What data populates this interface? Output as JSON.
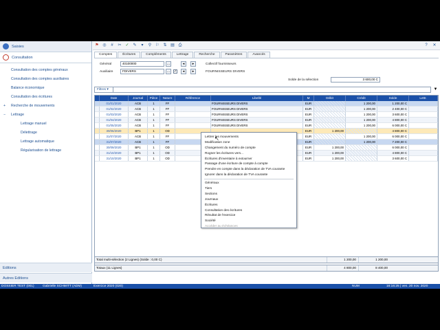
{
  "sidebar": {
    "header_saisies": "Saisies",
    "header_consultation": "Consultation",
    "items": [
      {
        "label": "Consultation des comptes généraux"
      },
      {
        "label": "Consultation des comptes auxiliaires"
      },
      {
        "label": "Balance économique"
      },
      {
        "label": "Consultation des écritures"
      }
    ],
    "group_recherche": "Recherche de mouvements",
    "group_lettrage": "Lettrage",
    "lettrage_items": [
      {
        "label": "Lettrage manuel"
      },
      {
        "label": "Délettrage"
      },
      {
        "label": "Lettrage automatique"
      },
      {
        "label": "Régularisation de lettrage"
      }
    ],
    "footer_editions": "Editions",
    "footer_autres": "Autres Editions"
  },
  "tabs": [
    "Comptes",
    "Écritures",
    "Compléments",
    "Lettrage",
    "Recherche",
    "Paramètres",
    "Avancés"
  ],
  "form": {
    "general_label": "Général",
    "general_value": "40100000",
    "general_desc": "Collectif fournisseurs",
    "auxiliaire_label": "Auxiliaire",
    "auxiliaire_value": "FDIVERS",
    "auxiliaire_desc": "FOURNISSEURS DIVERS",
    "solde_label": "Solde de la sélection",
    "solde_value": "3 600,00 C"
  },
  "filter": {
    "label": "Filtres"
  },
  "grid": {
    "columns": [
      "",
      "Date",
      "Journal",
      "Pièce",
      "Nature",
      "Référence",
      "Libellé",
      "M",
      "Débit",
      "Crédit",
      "Solde",
      "Lettr."
    ],
    "rows": [
      {
        "date": "01/01/2020",
        "journal": "ACB",
        "piece": "1",
        "nature": "FF",
        "ref": "",
        "libelle": "FOURNISSEURS DIVERS",
        "m": "EUR",
        "debit": "",
        "credit": "1 200,00",
        "solde": "1 200,00 C",
        "state": "hilite"
      },
      {
        "date": "01/02/2020",
        "journal": "ACB",
        "piece": "1",
        "nature": "FF",
        "ref": "",
        "libelle": "FOURNISSEURS DIVERS",
        "m": "EUR",
        "debit": "",
        "credit": "1 200,00",
        "solde": "2 400,00 C",
        "state": "odd"
      },
      {
        "date": "01/03/2020",
        "journal": "ACB",
        "piece": "1",
        "nature": "FF",
        "ref": "",
        "libelle": "FOURNISSEURS DIVERS",
        "m": "EUR",
        "debit": "",
        "credit": "1 200,00",
        "solde": "3 600,00 C",
        "state": "even"
      },
      {
        "date": "01/04/2020",
        "journal": "ACB",
        "piece": "1",
        "nature": "FF",
        "ref": "",
        "libelle": "FOURNISSEURS DIVERS",
        "m": "EUR",
        "debit": "",
        "credit": "1 200,00",
        "solde": "4 800,00 C",
        "state": "odd"
      },
      {
        "date": "01/05/2020",
        "journal": "ACB",
        "piece": "1",
        "nature": "FF",
        "ref": "",
        "libelle": "FOURNISSEURS DIVERS",
        "m": "EUR",
        "debit": "",
        "credit": "1 200,00",
        "solde": "6 000,00 C",
        "state": "even"
      },
      {
        "date": "30/06/2020",
        "journal": "BP1",
        "piece": "1",
        "nature": "OD",
        "ref": "",
        "libelle": "",
        "m": "EUR",
        "debit": "1 200,00",
        "credit": "",
        "solde": "4 800,00 C",
        "state": "sel"
      },
      {
        "date": "31/07/2020",
        "journal": "ACB",
        "piece": "1",
        "nature": "FF",
        "ref": "",
        "libelle": "",
        "m": "EUR",
        "debit": "",
        "credit": "1 200,00",
        "solde": "6 000,00 C",
        "state": "even"
      },
      {
        "date": "31/07/2020",
        "journal": "ACB",
        "piece": "1",
        "nature": "FF",
        "ref": "",
        "libelle": "",
        "m": "EUR",
        "debit": "",
        "credit": "1 200,00",
        "solde": "7 200,00 C",
        "state": "hilite"
      },
      {
        "date": "30/09/2020",
        "journal": "BP1",
        "piece": "1",
        "nature": "OD",
        "ref": "",
        "libelle": "",
        "m": "EUR",
        "debit": "1 200,00",
        "credit": "",
        "solde": "6 000,00 C",
        "state": "even"
      },
      {
        "date": "31/10/2020",
        "journal": "BP1",
        "piece": "1",
        "nature": "OD",
        "ref": "",
        "libelle": "",
        "m": "EUR",
        "debit": "1 200,00",
        "credit": "",
        "solde": "4 800,00 C",
        "state": "odd"
      },
      {
        "date": "31/10/2020",
        "journal": "BP1",
        "piece": "1",
        "nature": "OD",
        "ref": "",
        "libelle": "",
        "m": "EUR",
        "debit": "1 200,00",
        "credit": "",
        "solde": "3 600,00 C",
        "state": "even"
      }
    ]
  },
  "totals": {
    "multi_label": "Total multi-sélection (2 Lignes) (Solde : 0,00 C)",
    "multi_debit": "1 200,00",
    "multi_credit": "1 200,00",
    "total_label": "Totaux (11 Lignes)",
    "total_debit": "4 800,00",
    "total_credit": "8 400,00"
  },
  "context_menu": {
    "group1": [
      "Lettrer les mouvements",
      "Modification zone",
      "Changement du numéro de compte",
      "Rogner les écritures vers...",
      "Écritures d'inventaire à extourner",
      "Passage d'une écriture de compte à compte",
      "Prendre en compte dans la déclaration de TVA courante",
      "Ignorer dans la déclaration de TVA courante"
    ],
    "group2": [
      "Généraux",
      "Tiers",
      "Sections",
      "Journaux",
      "Écritures",
      "Consultation des écritures",
      "Résultat de l'exercice",
      "Société"
    ],
    "disabled_last": "Accéder au échéances"
  },
  "status": {
    "dossier": "DOSSIER TEST (001)",
    "user": "Gabrielle SCHMITT (ADM)",
    "exercice": "Exercice 2020 (020)",
    "num": "NUM",
    "time": "16:16:25 | ven. 20 nov. 2020"
  }
}
